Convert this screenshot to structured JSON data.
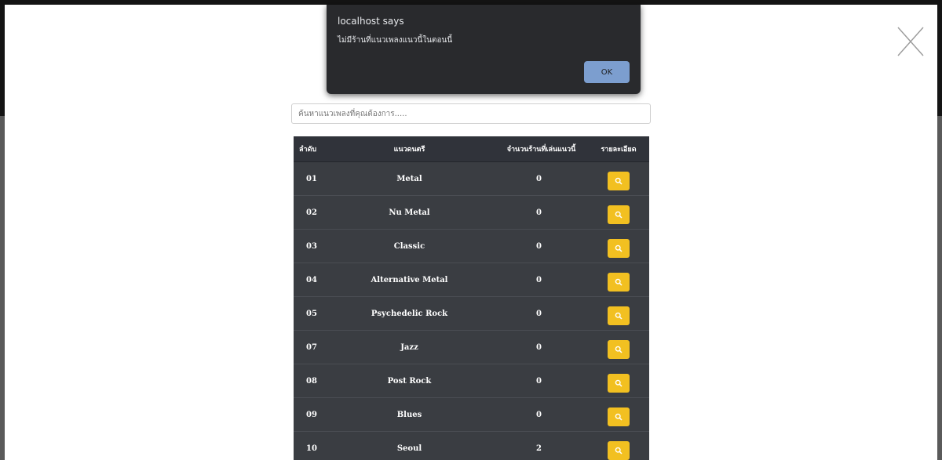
{
  "dialog": {
    "title": "localhost says",
    "message": "ไม่มีร้านที่แนวเพลงแนวนี้ในตอนนี้",
    "ok_label": "OK"
  },
  "search": {
    "placeholder": "ค้นหาแนวเพลงที่คุณต้องการ....."
  },
  "table": {
    "headers": [
      "ลำดับ",
      "แนวดนตรี",
      "จำนวนร้านที่เล่นแนวนี้",
      "รายละเอียด"
    ],
    "rows": [
      {
        "no": "01",
        "genre": "Metal",
        "count": "0"
      },
      {
        "no": "02",
        "genre": "Nu Metal",
        "count": "0"
      },
      {
        "no": "03",
        "genre": "Classic",
        "count": "0"
      },
      {
        "no": "04",
        "genre": "Alternative Metal",
        "count": "0"
      },
      {
        "no": "05",
        "genre": "Psychedelic Rock",
        "count": "0"
      },
      {
        "no": "07",
        "genre": "Jazz",
        "count": "0"
      },
      {
        "no": "08",
        "genre": "Post Rock",
        "count": "0"
      },
      {
        "no": "09",
        "genre": "Blues",
        "count": "0"
      },
      {
        "no": "10",
        "genre": "Seoul",
        "count": "2"
      }
    ]
  },
  "colors": {
    "accent": "#f2c021",
    "table_bg": "#3a3d42",
    "dialog_bg": "#292a2d",
    "ok_button": "#7c9ecf"
  },
  "icons": {
    "close": "close-icon",
    "view": "search-icon"
  }
}
